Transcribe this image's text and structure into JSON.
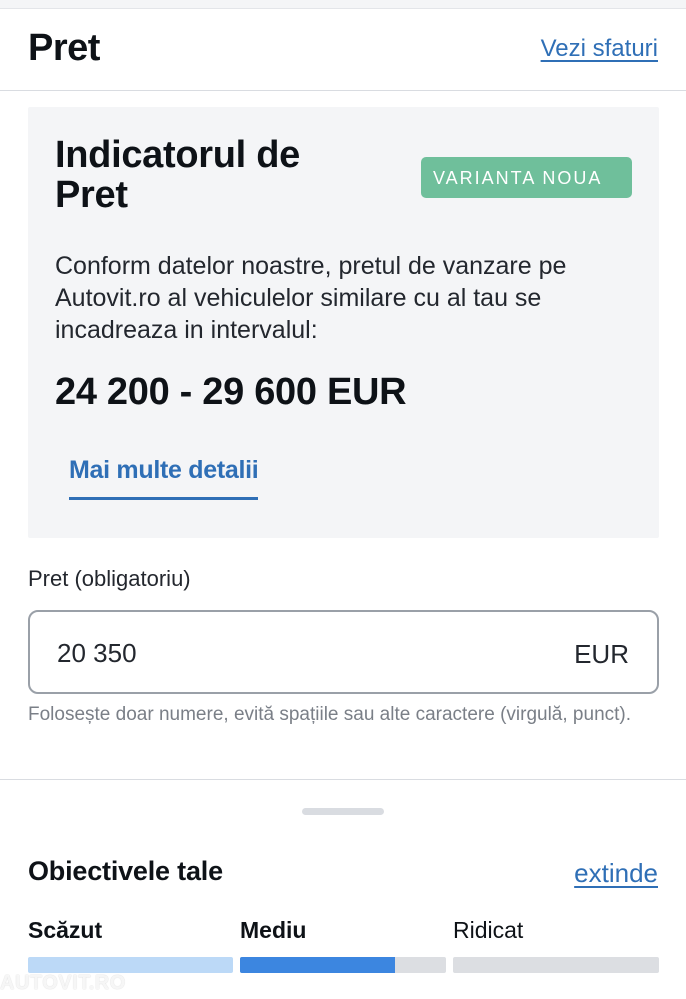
{
  "header": {
    "title": "Pret",
    "tips_link": "Vezi sfaturi"
  },
  "indicator": {
    "title": "Indicatorul de Pret",
    "badge": "VARIANTA NOUA",
    "description": "Conform datelor noastre, pretul de vanzare pe Autovit.ro al vehiculelor similare cu al tau se incadreaza in intervalul:",
    "range": "24 200 - 29 600 EUR",
    "details_link": "Mai multe detalii"
  },
  "price_field": {
    "label": "Pret (obligatoriu)",
    "value": "20 350",
    "unit": "EUR",
    "hint": "Folosește doar numere, evită spațiile sau alte caractere (virgulă, punct)."
  },
  "objectives": {
    "title": "Obiectivele tale",
    "expand_link": "extinde",
    "levels": [
      "Scăzut",
      "Mediu",
      "Ridicat"
    ],
    "medium_progress": 0.75
  },
  "watermark": "AUTOVIT.RO",
  "colors": {
    "accent": "#2f6fb6",
    "badge": "#6fbf9b",
    "progress": "#3c86e0",
    "progress_light": "#bcd9f7"
  }
}
